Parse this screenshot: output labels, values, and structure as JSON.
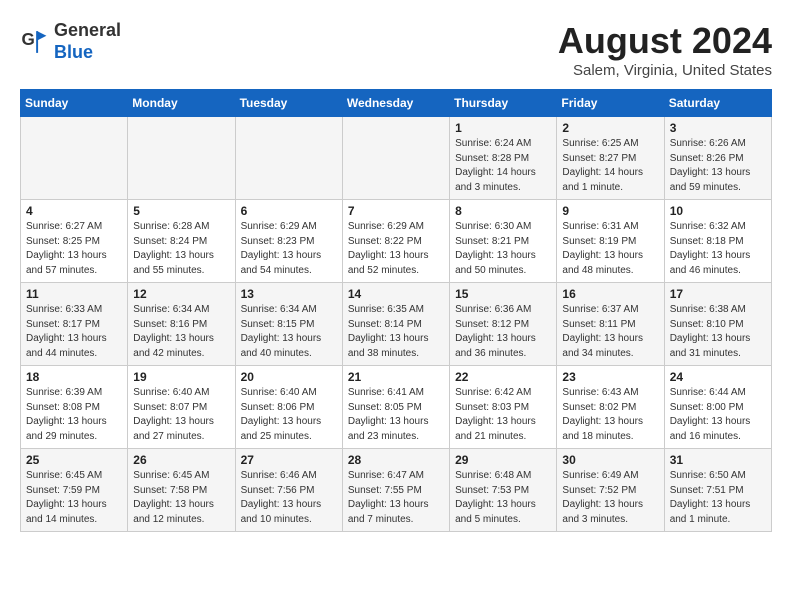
{
  "header": {
    "title": "August 2024",
    "subtitle": "Salem, Virginia, United States",
    "logo_line1": "General",
    "logo_line2": "Blue"
  },
  "days_of_week": [
    "Sunday",
    "Monday",
    "Tuesday",
    "Wednesday",
    "Thursday",
    "Friday",
    "Saturday"
  ],
  "weeks": [
    [
      {
        "day": "",
        "info": ""
      },
      {
        "day": "",
        "info": ""
      },
      {
        "day": "",
        "info": ""
      },
      {
        "day": "",
        "info": ""
      },
      {
        "day": "1",
        "info": "Sunrise: 6:24 AM\nSunset: 8:28 PM\nDaylight: 14 hours\nand 3 minutes."
      },
      {
        "day": "2",
        "info": "Sunrise: 6:25 AM\nSunset: 8:27 PM\nDaylight: 14 hours\nand 1 minute."
      },
      {
        "day": "3",
        "info": "Sunrise: 6:26 AM\nSunset: 8:26 PM\nDaylight: 13 hours\nand 59 minutes."
      }
    ],
    [
      {
        "day": "4",
        "info": "Sunrise: 6:27 AM\nSunset: 8:25 PM\nDaylight: 13 hours\nand 57 minutes."
      },
      {
        "day": "5",
        "info": "Sunrise: 6:28 AM\nSunset: 8:24 PM\nDaylight: 13 hours\nand 55 minutes."
      },
      {
        "day": "6",
        "info": "Sunrise: 6:29 AM\nSunset: 8:23 PM\nDaylight: 13 hours\nand 54 minutes."
      },
      {
        "day": "7",
        "info": "Sunrise: 6:29 AM\nSunset: 8:22 PM\nDaylight: 13 hours\nand 52 minutes."
      },
      {
        "day": "8",
        "info": "Sunrise: 6:30 AM\nSunset: 8:21 PM\nDaylight: 13 hours\nand 50 minutes."
      },
      {
        "day": "9",
        "info": "Sunrise: 6:31 AM\nSunset: 8:19 PM\nDaylight: 13 hours\nand 48 minutes."
      },
      {
        "day": "10",
        "info": "Sunrise: 6:32 AM\nSunset: 8:18 PM\nDaylight: 13 hours\nand 46 minutes."
      }
    ],
    [
      {
        "day": "11",
        "info": "Sunrise: 6:33 AM\nSunset: 8:17 PM\nDaylight: 13 hours\nand 44 minutes."
      },
      {
        "day": "12",
        "info": "Sunrise: 6:34 AM\nSunset: 8:16 PM\nDaylight: 13 hours\nand 42 minutes."
      },
      {
        "day": "13",
        "info": "Sunrise: 6:34 AM\nSunset: 8:15 PM\nDaylight: 13 hours\nand 40 minutes."
      },
      {
        "day": "14",
        "info": "Sunrise: 6:35 AM\nSunset: 8:14 PM\nDaylight: 13 hours\nand 38 minutes."
      },
      {
        "day": "15",
        "info": "Sunrise: 6:36 AM\nSunset: 8:12 PM\nDaylight: 13 hours\nand 36 minutes."
      },
      {
        "day": "16",
        "info": "Sunrise: 6:37 AM\nSunset: 8:11 PM\nDaylight: 13 hours\nand 34 minutes."
      },
      {
        "day": "17",
        "info": "Sunrise: 6:38 AM\nSunset: 8:10 PM\nDaylight: 13 hours\nand 31 minutes."
      }
    ],
    [
      {
        "day": "18",
        "info": "Sunrise: 6:39 AM\nSunset: 8:08 PM\nDaylight: 13 hours\nand 29 minutes."
      },
      {
        "day": "19",
        "info": "Sunrise: 6:40 AM\nSunset: 8:07 PM\nDaylight: 13 hours\nand 27 minutes."
      },
      {
        "day": "20",
        "info": "Sunrise: 6:40 AM\nSunset: 8:06 PM\nDaylight: 13 hours\nand 25 minutes."
      },
      {
        "day": "21",
        "info": "Sunrise: 6:41 AM\nSunset: 8:05 PM\nDaylight: 13 hours\nand 23 minutes."
      },
      {
        "day": "22",
        "info": "Sunrise: 6:42 AM\nSunset: 8:03 PM\nDaylight: 13 hours\nand 21 minutes."
      },
      {
        "day": "23",
        "info": "Sunrise: 6:43 AM\nSunset: 8:02 PM\nDaylight: 13 hours\nand 18 minutes."
      },
      {
        "day": "24",
        "info": "Sunrise: 6:44 AM\nSunset: 8:00 PM\nDaylight: 13 hours\nand 16 minutes."
      }
    ],
    [
      {
        "day": "25",
        "info": "Sunrise: 6:45 AM\nSunset: 7:59 PM\nDaylight: 13 hours\nand 14 minutes."
      },
      {
        "day": "26",
        "info": "Sunrise: 6:45 AM\nSunset: 7:58 PM\nDaylight: 13 hours\nand 12 minutes."
      },
      {
        "day": "27",
        "info": "Sunrise: 6:46 AM\nSunset: 7:56 PM\nDaylight: 13 hours\nand 10 minutes."
      },
      {
        "day": "28",
        "info": "Sunrise: 6:47 AM\nSunset: 7:55 PM\nDaylight: 13 hours\nand 7 minutes."
      },
      {
        "day": "29",
        "info": "Sunrise: 6:48 AM\nSunset: 7:53 PM\nDaylight: 13 hours\nand 5 minutes."
      },
      {
        "day": "30",
        "info": "Sunrise: 6:49 AM\nSunset: 7:52 PM\nDaylight: 13 hours\nand 3 minutes."
      },
      {
        "day": "31",
        "info": "Sunrise: 6:50 AM\nSunset: 7:51 PM\nDaylight: 13 hours\nand 1 minute."
      }
    ]
  ]
}
